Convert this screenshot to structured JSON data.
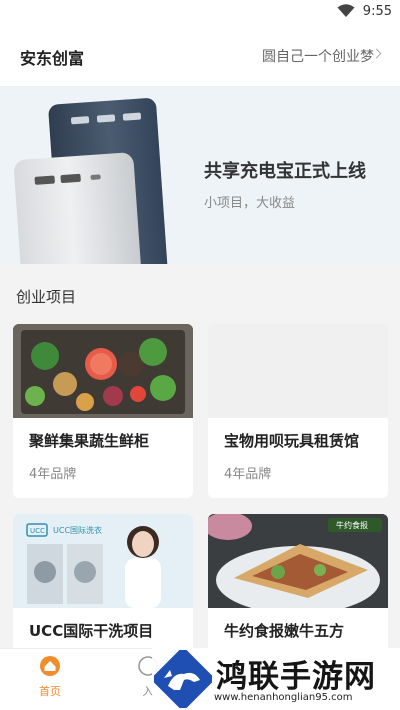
{
  "status_bar": {
    "time": "9:55",
    "wifi_icon": "wifi-icon"
  },
  "header": {
    "brand": "安东创富",
    "slogan": "圆自己一个创业梦",
    "chevron_icon": "chevron-right-icon"
  },
  "banner": {
    "title": "共享充电宝正式上线",
    "subtitle": "小项目，大收益"
  },
  "section": {
    "title": "创业项目"
  },
  "projects": [
    {
      "name": "聚鲜集果蔬生鲜柜",
      "tag": "4年品牌"
    },
    {
      "name": "宝物用呗玩具租赁馆",
      "tag": "4年品牌"
    },
    {
      "name": "UCC国际干洗项目",
      "image_text": "UCC国际洗衣",
      "tag": ""
    },
    {
      "name": "牛约食报嫩牛五方",
      "image_text": "牛约食报",
      "tag": ""
    }
  ],
  "nav": {
    "home": "首页",
    "second": "入"
  },
  "watermark": {
    "title": "鸿联手游网",
    "url": "www.henanhonglian95.com"
  },
  "colors": {
    "accent": "#f08c2a",
    "background": "#f3f3f3"
  }
}
